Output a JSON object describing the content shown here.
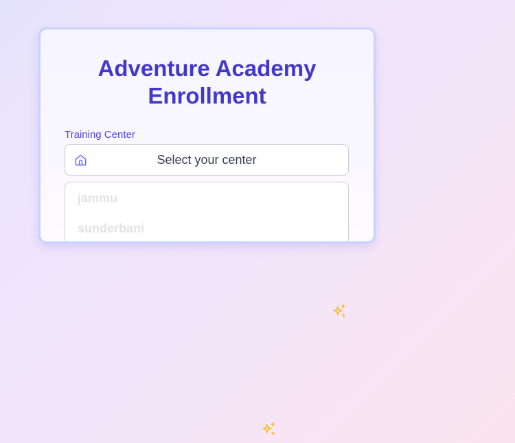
{
  "form": {
    "title_line1": "Adventure Academy",
    "title_line2": "Enrollment",
    "center_label": "Training Center",
    "center_select": {
      "value": "Select your center",
      "icon": "home-icon"
    },
    "dropdown_options": [
      "jammu",
      "sunderbani"
    ]
  },
  "decorations": {
    "sparkle_icon": "sparkle-icon",
    "sparkle_color": "#fbbf24"
  },
  "colors": {
    "accent": "#4338ca",
    "label": "#4f46e5",
    "card_border": "#c7d2fe"
  }
}
